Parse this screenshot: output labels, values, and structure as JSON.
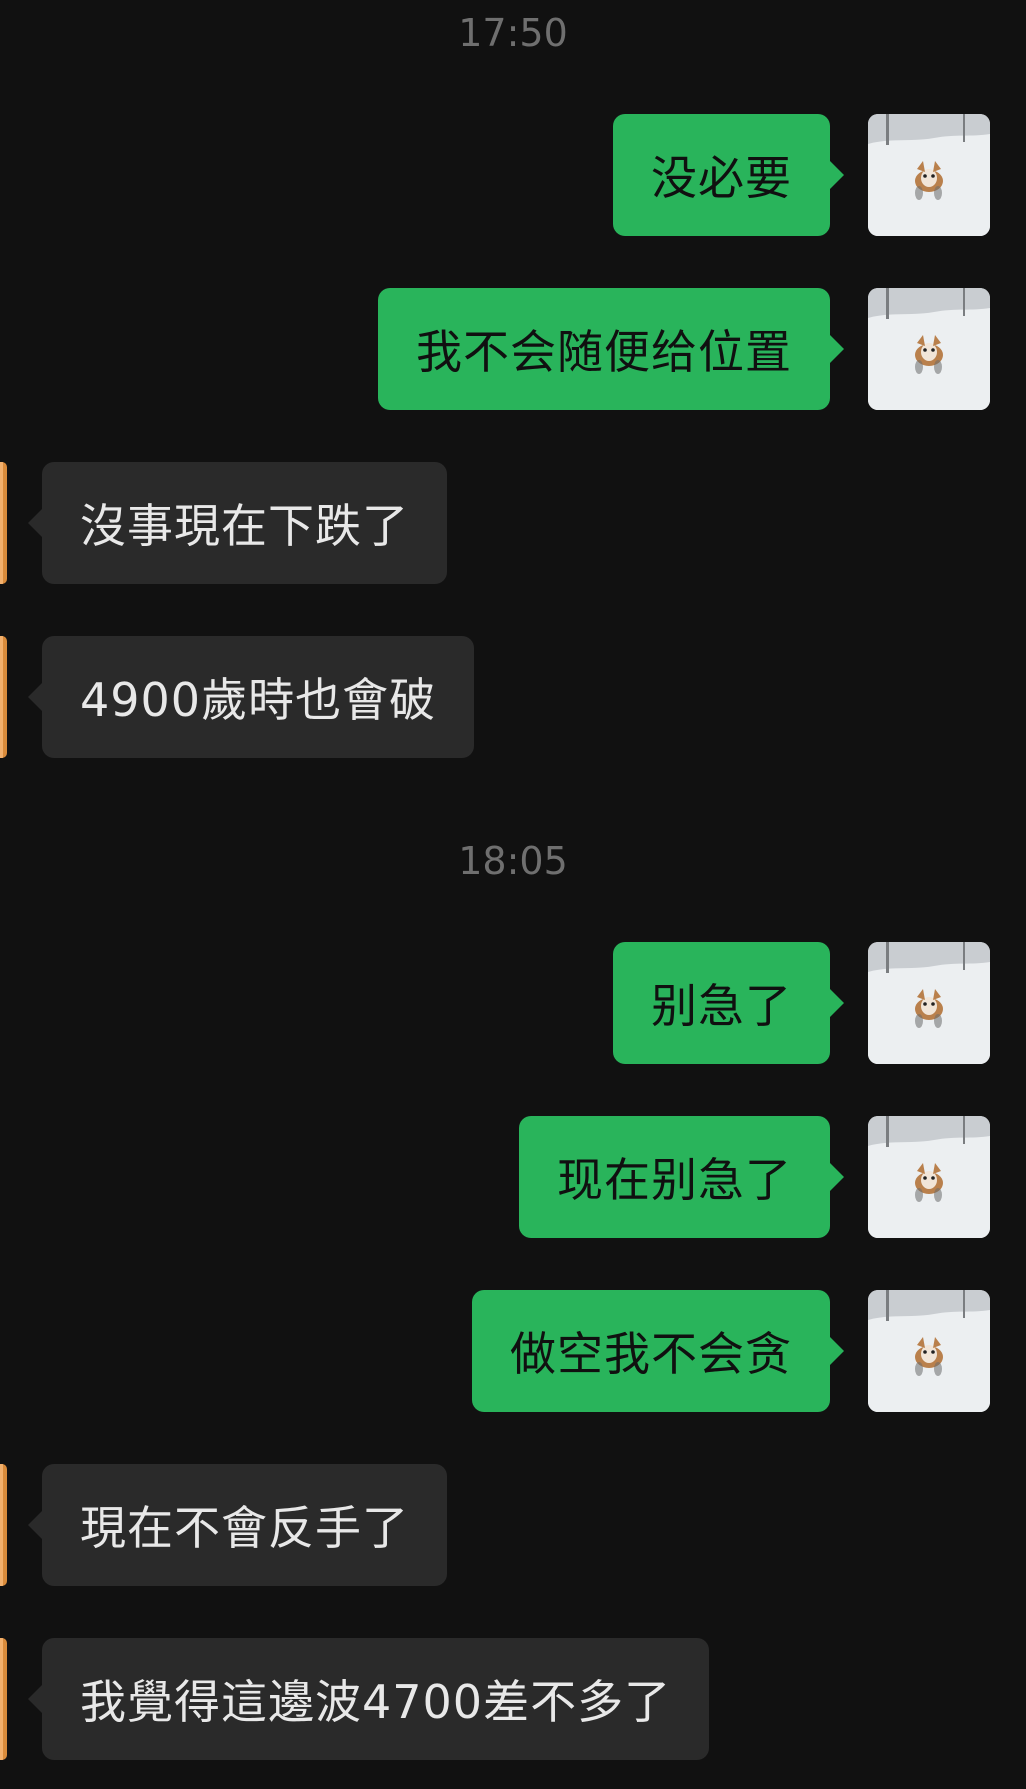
{
  "chat": {
    "timestamps": [
      "17:50",
      "18:05"
    ],
    "messages": [
      {
        "direction": "outgoing",
        "text": "没必要"
      },
      {
        "direction": "outgoing",
        "text": "我不会随便给位置"
      },
      {
        "direction": "incoming",
        "text": "沒事現在下跌了"
      },
      {
        "direction": "incoming",
        "text": "4900歲時也會破"
      },
      {
        "direction": "outgoing",
        "text": "别急了"
      },
      {
        "direction": "outgoing",
        "text": "现在别急了"
      },
      {
        "direction": "outgoing",
        "text": "做空我不会贪"
      },
      {
        "direction": "incoming",
        "text": "現在不會反手了"
      },
      {
        "direction": "incoming",
        "text": "我覺得這邊波4700差不多了"
      }
    ]
  },
  "avatars": {
    "own": "dog-in-snow-avatar-icon",
    "peer": "peer-avatar-icon"
  },
  "colors": {
    "background": "#111111",
    "outgoing_bubble": "#29b45b",
    "incoming_bubble": "#2a2a2a",
    "timestamp_text": "#6f6f6f"
  }
}
